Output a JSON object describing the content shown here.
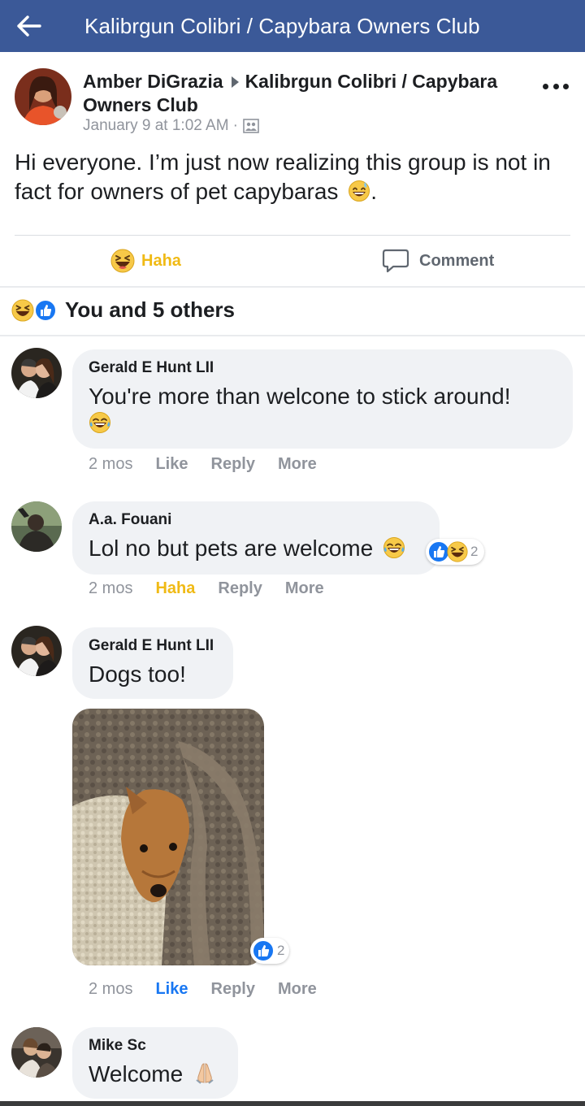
{
  "topbar": {
    "title": "Kalibrgun Colibri / Capybara Owners Club",
    "back_icon": "arrow-left-icon",
    "color": "#3b5998"
  },
  "post": {
    "author": "Amber DiGrazia",
    "group": "Kalibrgun Colibri / Capybara Owners Club",
    "timestamp": "January 9 at 1:02 AM",
    "separator": "·",
    "body": "Hi everyone. I’m just now realizing this group is not in fact for owners of pet capybaras",
    "body_end": ".",
    "actions": {
      "reaction_label": "Haha",
      "comment_label": "Comment"
    },
    "reaction_summary": "You and 5 others"
  },
  "comments": [
    {
      "name": "Gerald E Hunt LII",
      "text": "You're more than welcone to stick around!",
      "time": "2 mos",
      "like": "Like",
      "reply": "Reply",
      "more": "More"
    },
    {
      "name": "A.a. Fouani",
      "text": "Lol no but pets are welcome",
      "time": "2 mos",
      "like": "Haha",
      "reply": "Reply",
      "more": "More",
      "reaction_count": "2"
    },
    {
      "name": "Gerald E Hunt LII",
      "text": "Dogs too!",
      "time": "2 mos",
      "like": "Like",
      "reply": "Reply",
      "more": "More",
      "reaction_count": "2"
    },
    {
      "name": "Mike Sc",
      "text": "Welcome"
    }
  ],
  "colors": {
    "haha": "#f0ba15",
    "like": "#1877f2",
    "meta": "#90949c",
    "bubble": "#f0f2f5"
  }
}
